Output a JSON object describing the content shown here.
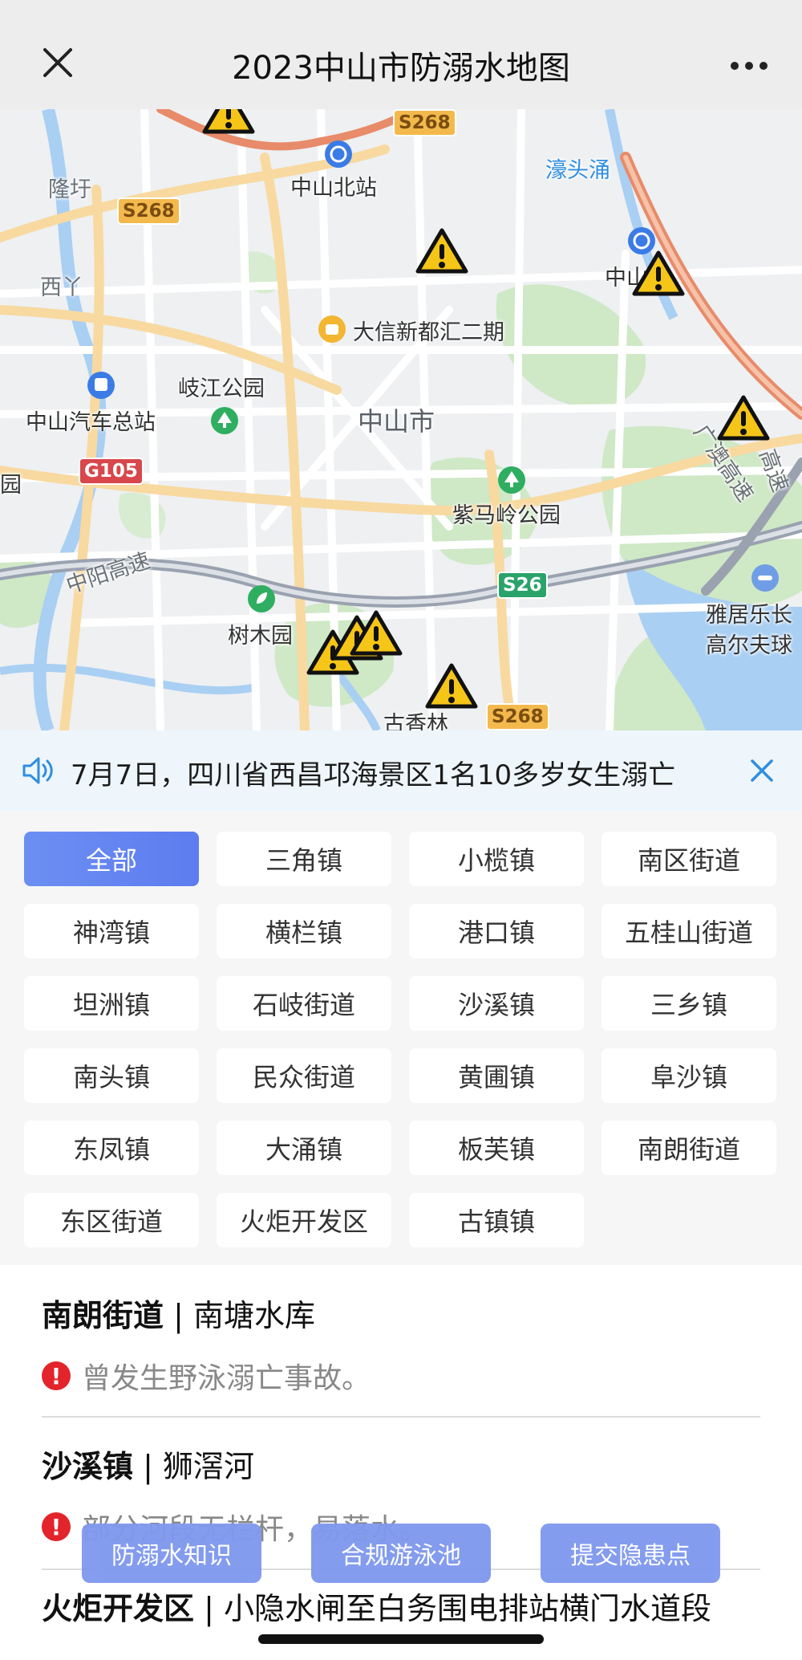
{
  "header": {
    "title": "2023中山市防溺水地图"
  },
  "map": {
    "labels": {
      "longwu": "隆圩",
      "xiya": "西丫",
      "zhongshan_north": "中山北站",
      "haotouchong": "濠头涌",
      "zhong_partial": "中山",
      "daxin": "大信新都汇二期",
      "qijiang_park": "岐江公园",
      "bus_station": "中山汽车总站",
      "zhongshan_city": "中山市",
      "yuan_partial": "园",
      "zimaling": "紫马岭公园",
      "shumuyuan": "树木园",
      "guxianglin": "古香林",
      "yajuyue": "雅居乐长",
      "gaoerfu": "高尔夫球",
      "zhongyang_hw": "中阳高速",
      "guangao_hw": "广澳高速",
      "gaosu_partial": "高速"
    },
    "shields": {
      "s268_top": "S268",
      "s268_left": "S268",
      "g105": "G105",
      "s26": "S26",
      "s268_bottom": "S268"
    }
  },
  "notice": {
    "text": "7月7日，四川省西昌邛海景区1名10多岁女生溺亡"
  },
  "filters": [
    "全部",
    "三角镇",
    "小榄镇",
    "南区街道",
    "神湾镇",
    "横栏镇",
    "港口镇",
    "五桂山街道",
    "坦洲镇",
    "石岐街道",
    "沙溪镇",
    "三乡镇",
    "南头镇",
    "民众街道",
    "黄圃镇",
    "阜沙镇",
    "东凤镇",
    "大涌镇",
    "板芙镇",
    "南朗街道",
    "东区街道",
    "火炬开发区",
    "古镇镇"
  ],
  "active_filter": "全部",
  "list": [
    {
      "town": "南朗街道",
      "sep": " | ",
      "place": "南塘水库",
      "desc": "曾发生野泳溺亡事故。"
    },
    {
      "town": "沙溪镇",
      "sep": " | ",
      "place": "狮滘河",
      "desc": "部分河段无栏杆，易落水。"
    },
    {
      "town": "火炬开发区",
      "sep": " | ",
      "place": "小隐水闸至白务围电排站横门水道段",
      "desc": ""
    }
  ],
  "buttons": {
    "knowledge": "防溺水知识",
    "pools": "合规游泳池",
    "report": "提交隐患点"
  },
  "colors": {
    "accent": "#5d7cf0",
    "warning": "#f5c518",
    "alert": "#e3242b"
  }
}
